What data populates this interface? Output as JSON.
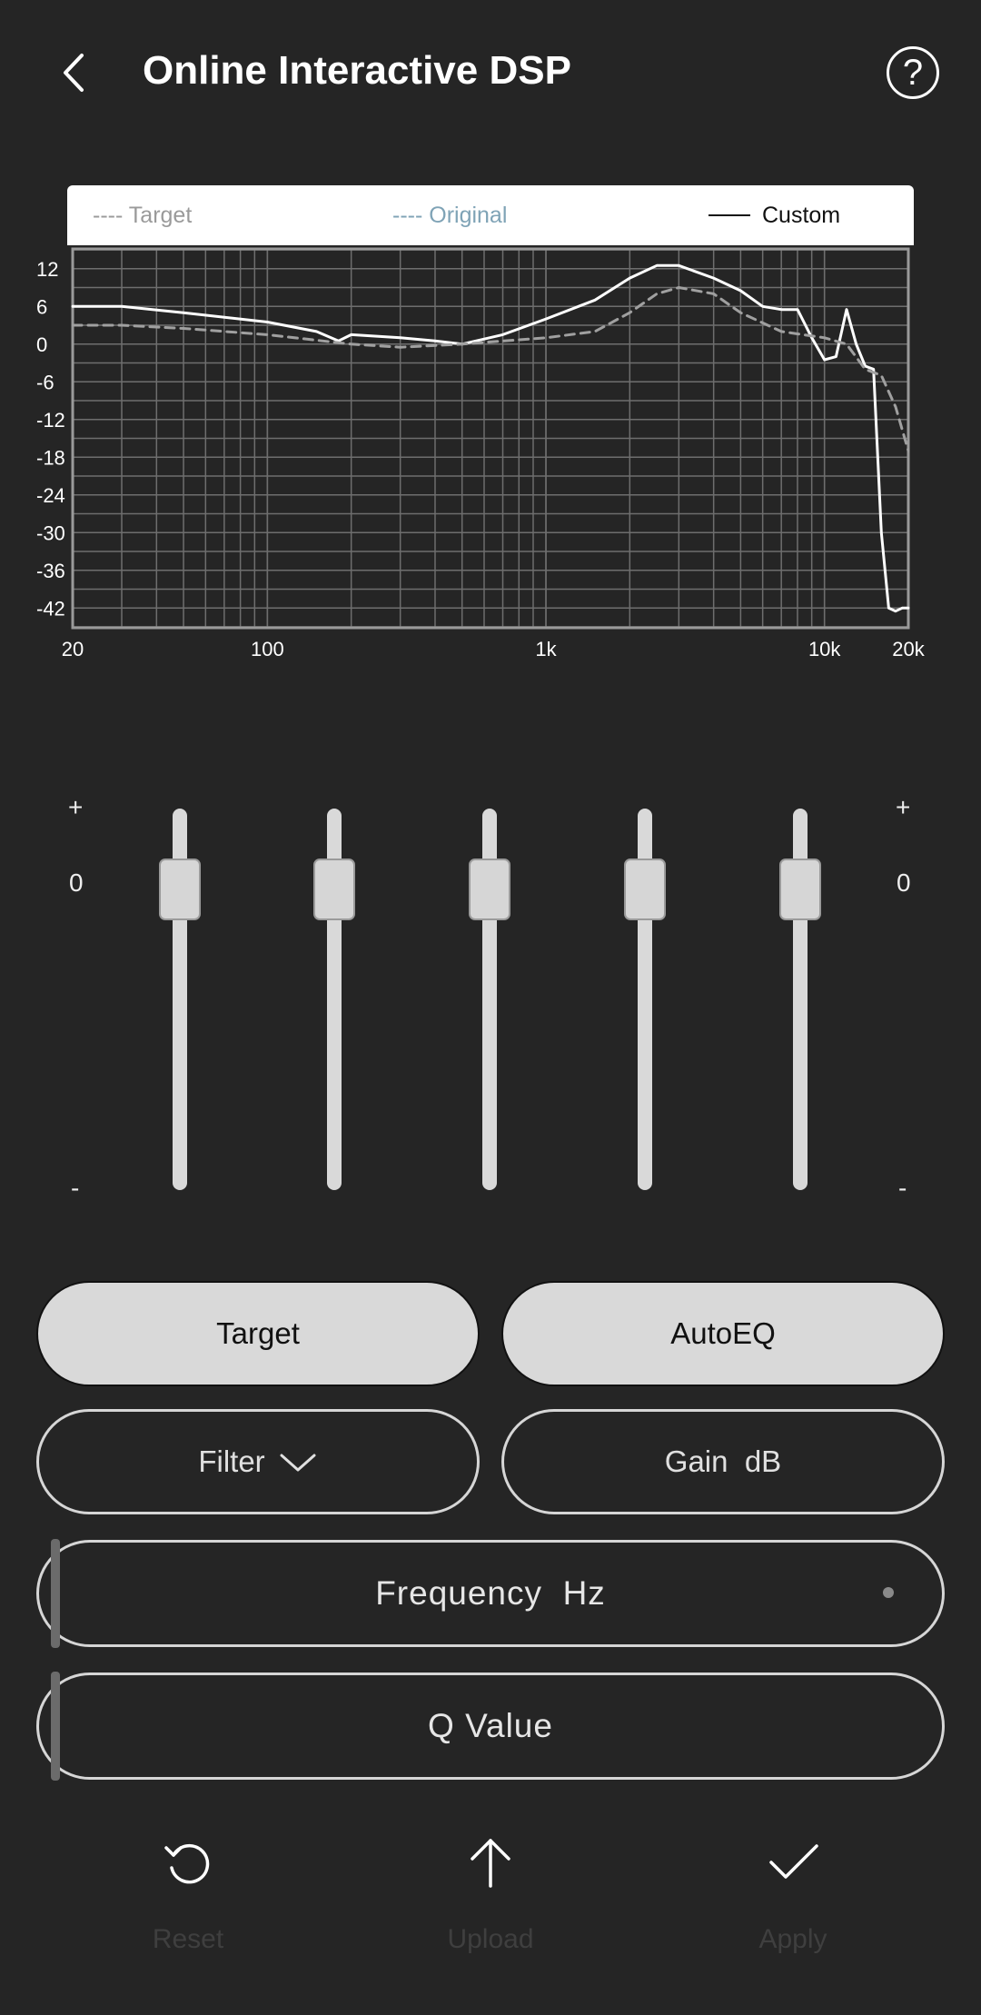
{
  "header": {
    "title": "Online Interactive DSP",
    "help_glyph": "?"
  },
  "legend": {
    "target": "---- Target",
    "original": "---- Original",
    "custom": "Custom"
  },
  "chart_data": {
    "type": "line",
    "x_scale": "log",
    "xlim": [
      20,
      20000
    ],
    "ylim": [
      -45,
      15
    ],
    "x_ticks": [
      "20",
      "100",
      "1k",
      "10k",
      "20k"
    ],
    "y_ticks": [
      "12",
      "6",
      "0",
      "-6",
      "-12",
      "-18",
      "-24",
      "-30",
      "-36",
      "-42"
    ],
    "series": [
      {
        "name": "Custom",
        "style": "solid",
        "color": "#ffffff",
        "x": [
          20,
          30,
          50,
          100,
          150,
          180,
          200,
          300,
          400,
          500,
          700,
          1000,
          1500,
          2000,
          2500,
          3000,
          4000,
          5000,
          6000,
          7000,
          8000,
          9000,
          10000,
          11000,
          12000,
          13000,
          14000,
          15000,
          16000,
          17000,
          18000,
          19000,
          20000
        ],
        "y": [
          6,
          6,
          5,
          3.5,
          2,
          0.5,
          1.5,
          1,
          0.5,
          0,
          1.5,
          4,
          7,
          10.5,
          12.5,
          12.5,
          10.5,
          8.5,
          6,
          5.5,
          5.5,
          1,
          -2.5,
          -2,
          5.5,
          0,
          -3.5,
          -4,
          -30,
          -42,
          -42.5,
          -42,
          -42
        ]
      },
      {
        "name": "Target",
        "style": "dashed",
        "color": "#a0a0a0",
        "x": [
          20,
          30,
          50,
          100,
          200,
          300,
          500,
          700,
          1000,
          1500,
          2000,
          2500,
          3000,
          4000,
          5000,
          7000,
          10000,
          12000,
          14000,
          16000,
          18000,
          20000
        ],
        "y": [
          3,
          3,
          2.5,
          1.5,
          0,
          -0.5,
          0,
          0.5,
          1,
          2,
          5,
          8,
          9,
          8,
          5,
          2,
          1,
          0,
          -4,
          -5,
          -10,
          -17
        ]
      }
    ]
  },
  "equalizer": {
    "left_plus": "+",
    "left_zero": "0",
    "left_minus": "-",
    "right_plus": "+",
    "right_zero": "0",
    "right_minus": "-",
    "bands": [
      {
        "gain_db": 0
      },
      {
        "gain_db": 0
      },
      {
        "gain_db": 0
      },
      {
        "gain_db": 0
      },
      {
        "gain_db": 0
      }
    ]
  },
  "controls": {
    "target": "Target",
    "autoeq": "AutoEQ",
    "filter": "Filter",
    "gain": "Gain  dB",
    "frequency": "Frequency  Hz",
    "q_value": "Q Value"
  },
  "actions": {
    "reset": "Reset",
    "upload": "Upload",
    "apply": "Apply"
  },
  "colors": {
    "background": "#252525",
    "button_fill": "#d9d9d9",
    "grid": "#6e6e6e",
    "disabled_label": "#3f3f3f"
  }
}
